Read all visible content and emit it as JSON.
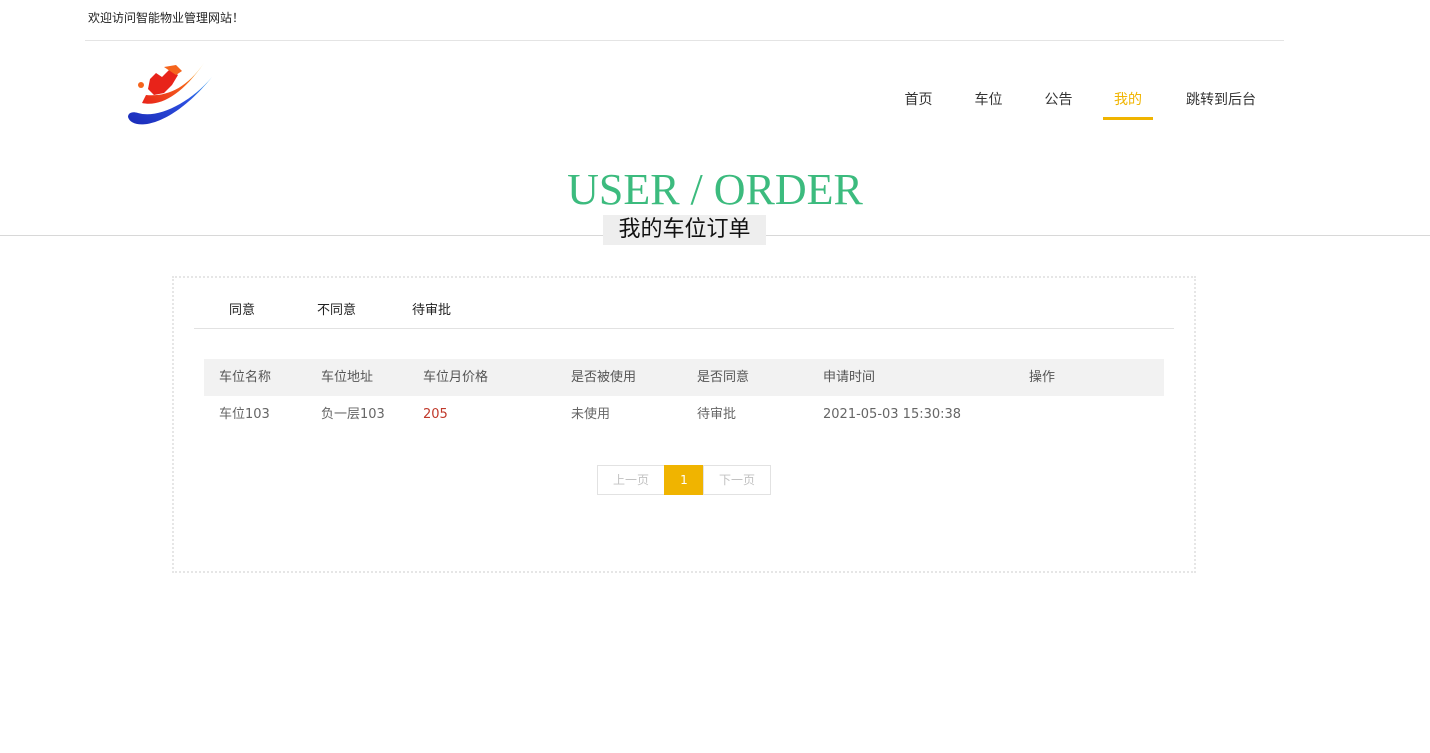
{
  "header": {
    "welcome_text": "欢迎访问智能物业管理网站！"
  },
  "nav": {
    "items": [
      {
        "label": "首页",
        "active": false
      },
      {
        "label": "车位",
        "active": false
      },
      {
        "label": "公告",
        "active": false
      },
      {
        "label": "我的",
        "active": true
      },
      {
        "label": "跳转到后台",
        "active": false
      }
    ]
  },
  "page_heading": {
    "title_en": "USER / ORDER",
    "title_cn": "我的车位订单"
  },
  "tabs": [
    "同意",
    "不同意",
    "待审批"
  ],
  "table": {
    "columns": [
      "车位名称",
      "车位地址",
      "车位月价格",
      "是否被使用",
      "是否同意",
      "申请时间",
      "操作"
    ],
    "rows": [
      [
        "车位103",
        "负一层103",
        "205",
        "未使用",
        "待审批",
        "2021-05-03 15:30:38",
        ""
      ]
    ]
  },
  "pagination": {
    "prev_label": "上一页",
    "current_page": "1",
    "next_label": "下一页"
  },
  "colors": {
    "accent": "#f0b400",
    "heading_green": "#3cbb7e",
    "price_red": "#c0392b"
  },
  "icons": {
    "logo": "brand-logo-icon"
  }
}
